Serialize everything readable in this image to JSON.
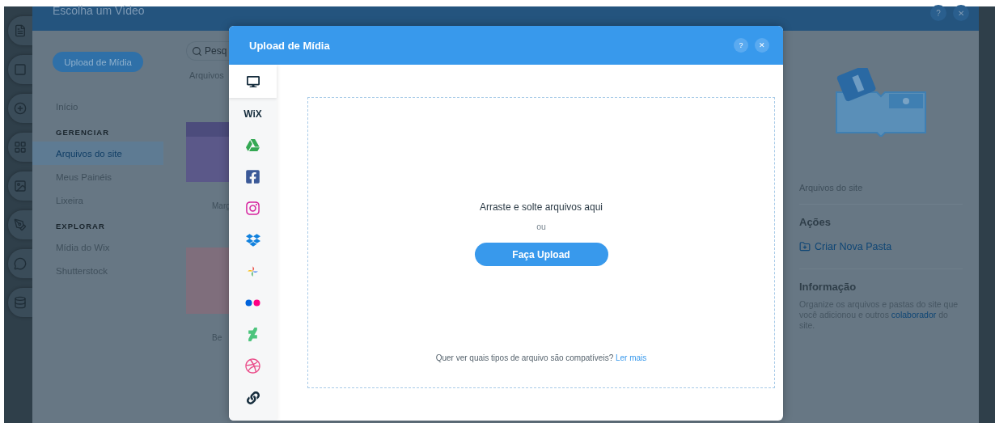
{
  "background_panel": {
    "title": "Escolha um Vídeo",
    "help_glyph": "?",
    "close_glyph": "✕",
    "upload_button": "Upload de Mídia",
    "nav": [
      {
        "kind": "item",
        "label": "Início",
        "selected": false
      },
      {
        "kind": "heading",
        "label": "GERENCIAR"
      },
      {
        "kind": "item",
        "label": "Arquivos do site",
        "selected": true
      },
      {
        "kind": "item",
        "label": "Meus Painéis",
        "selected": false
      },
      {
        "kind": "item",
        "label": "Lixeira",
        "selected": false
      },
      {
        "kind": "heading",
        "label": "EXPLORAR"
      },
      {
        "kind": "item",
        "label": "Mídia do Wix",
        "selected": false
      },
      {
        "kind": "item",
        "label": "Shutterstock",
        "selected": false
      }
    ],
    "search": {
      "placeholder": "Pesq"
    },
    "breadcrumb": "Arquivos",
    "thumbnails": [
      {
        "kind": "banner",
        "caption": "Marg"
      },
      {
        "kind": "photo",
        "caption": "Be"
      }
    ],
    "details": {
      "folder_name": "Arquivos do site",
      "actions_title": "Ações",
      "new_folder": "Criar Nova Pasta",
      "info_title": "Informação",
      "info_text": "Organize os arquivos e pastas do site que você adicionou e outros",
      "info_link": "colaborador",
      "info_tail": "do site."
    }
  },
  "modal": {
    "title": "Upload de Mídia",
    "help_glyph": "?",
    "close_glyph": "✕",
    "sources": [
      {
        "kind": "computer",
        "selected": true
      },
      {
        "kind": "wix",
        "label": "WiX",
        "selected": false
      },
      {
        "kind": "drive",
        "selected": false
      },
      {
        "kind": "facebook",
        "selected": false
      },
      {
        "kind": "instagram",
        "selected": false
      },
      {
        "kind": "dropbox",
        "selected": false
      },
      {
        "kind": "photos",
        "selected": false
      },
      {
        "kind": "flickr",
        "selected": false
      },
      {
        "kind": "deviantart",
        "selected": false
      },
      {
        "kind": "dribbble",
        "selected": false
      },
      {
        "kind": "link",
        "selected": false
      }
    ],
    "drop_text": "Arraste e solte arquivos aqui",
    "or_text": "ou",
    "upload_button": "Faça Upload",
    "help_text": "Quer ver quais tipos de arquivo são compatíveis?",
    "help_link": "Ler mais"
  }
}
